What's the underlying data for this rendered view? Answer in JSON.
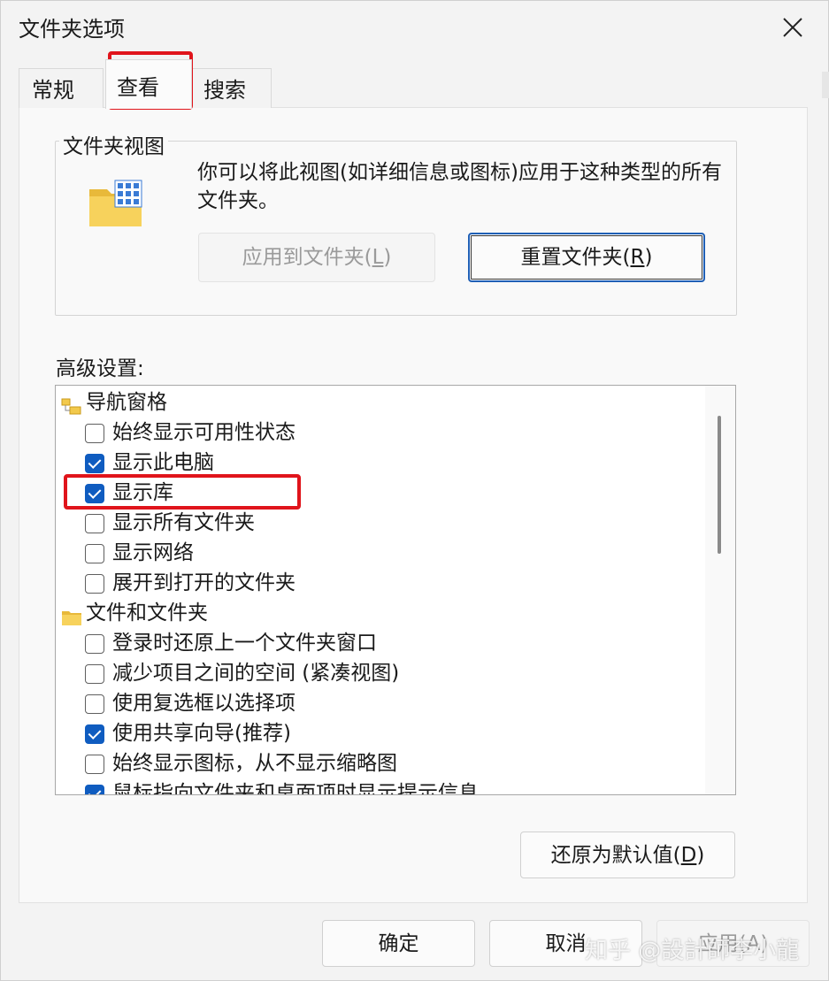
{
  "window": {
    "title": "文件夹选项"
  },
  "tabs": [
    {
      "label": "常规",
      "selected": false
    },
    {
      "label": "查看",
      "selected": true
    },
    {
      "label": "搜索",
      "selected": false
    }
  ],
  "folder_views": {
    "group_title": "文件夹视图",
    "description": "你可以将此视图(如详细信息或图标)应用于这种类型的所有文件夹。",
    "apply_button": {
      "text": "应用到文件夹(",
      "accel": "L",
      "close": ")",
      "enabled": false
    },
    "reset_button": {
      "text": "重置文件夹(",
      "accel": "R",
      "close": ")",
      "enabled": true
    }
  },
  "advanced": {
    "label": "高级设置:",
    "items": [
      {
        "kind": "category",
        "label": "导航窗格",
        "icon": "nav-pane-icon"
      },
      {
        "kind": "option",
        "label": "始终显示可用性状态",
        "checked": false
      },
      {
        "kind": "option",
        "label": "显示此电脑",
        "checked": true
      },
      {
        "kind": "option",
        "label": "显示库",
        "checked": true
      },
      {
        "kind": "option",
        "label": "显示所有文件夹",
        "checked": false
      },
      {
        "kind": "option",
        "label": "显示网络",
        "checked": false
      },
      {
        "kind": "option",
        "label": "展开到打开的文件夹",
        "checked": false
      },
      {
        "kind": "category",
        "label": "文件和文件夹",
        "icon": "folder-icon"
      },
      {
        "kind": "option",
        "label": "登录时还原上一个文件夹窗口",
        "checked": false
      },
      {
        "kind": "option",
        "label": "减少项目之间的空间 (紧凑视图)",
        "checked": false
      },
      {
        "kind": "option",
        "label": "使用复选框以选择项",
        "checked": false
      },
      {
        "kind": "option",
        "label": "使用共享向导(推荐)",
        "checked": true
      },
      {
        "kind": "option",
        "label": "始终显示图标，从不显示缩略图",
        "checked": false
      },
      {
        "kind": "option",
        "label": "鼠标指向文件夹和桌面项时显示提示信息",
        "checked": true
      }
    ]
  },
  "buttons": {
    "restore_defaults": {
      "text": "还原为默认值(",
      "accel": "D",
      "close": ")"
    },
    "ok": "确定",
    "cancel": "取消",
    "apply": "应用(A)"
  },
  "watermark": "知乎 @設計師李小龍",
  "colors": {
    "accent": "#0f5cc0",
    "highlight": "#e0141b"
  }
}
